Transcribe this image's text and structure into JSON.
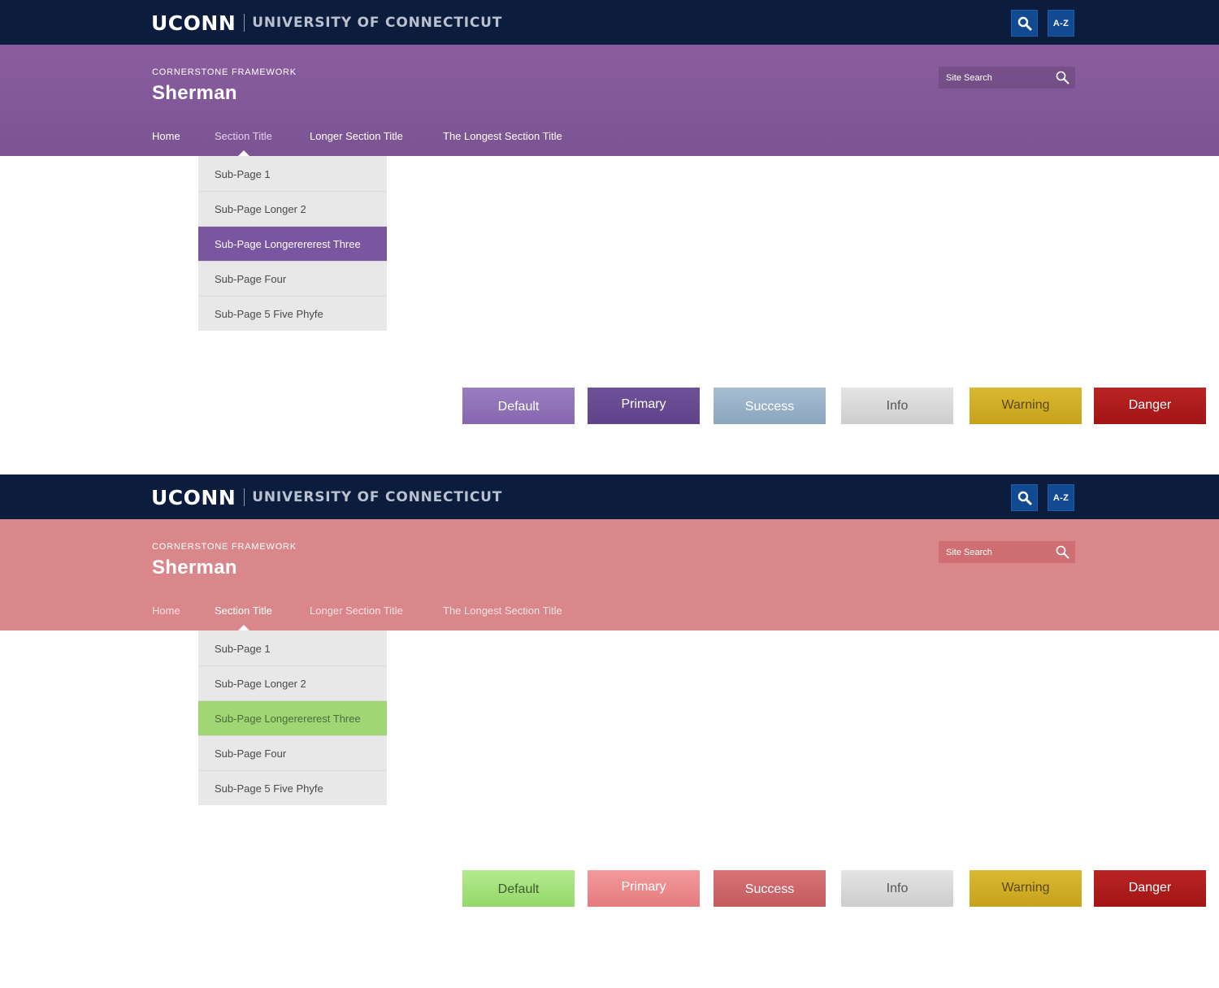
{
  "brand": {
    "logo_word": "UCONN",
    "university_name": "UNIVERSITY OF CONNECTICUT",
    "az_label": "A-Z"
  },
  "colors": {
    "top_bar": "#0b1c3d",
    "variant1_band": "#8a5d9e",
    "variant1_highlight": "#7a55a0",
    "variant2_band": "#d9878b",
    "variant2_highlight": "#a0d673"
  },
  "variants": [
    {
      "overline": "CORNERSTONE FRAMEWORK",
      "site_title": "Sherman",
      "search_placeholder": "Site Search",
      "nav": [
        "Home",
        "Section Title",
        "Longer Section Title",
        "The Longest Section Title"
      ],
      "active_nav": "Section Title",
      "dropdown": [
        "Sub-Page 1",
        "Sub-Page Longer 2",
        "Sub-Page Longerererest Three",
        "Sub-Page Four",
        "Sub-Page 5 Five Phyfe"
      ],
      "highlighted_item": "Sub-Page Longerererest Three",
      "buttons": [
        "Default",
        "Primary",
        "Success",
        "Info",
        "Warning",
        "Danger"
      ]
    },
    {
      "overline": "CORNERSTONE FRAMEWORK",
      "site_title": "Sherman",
      "search_placeholder": "Site Search",
      "nav": [
        "Home",
        "Section Title",
        "Longer Section Title",
        "The Longest Section Title"
      ],
      "active_nav": "Section Title",
      "dropdown": [
        "Sub-Page 1",
        "Sub-Page Longer 2",
        "Sub-Page Longerererest Three",
        "Sub-Page Four",
        "Sub-Page 5 Five Phyfe"
      ],
      "highlighted_item": "Sub-Page Longerererest Three",
      "buttons": [
        "Default",
        "Primary",
        "Success",
        "Info",
        "Warning",
        "Danger"
      ]
    }
  ]
}
